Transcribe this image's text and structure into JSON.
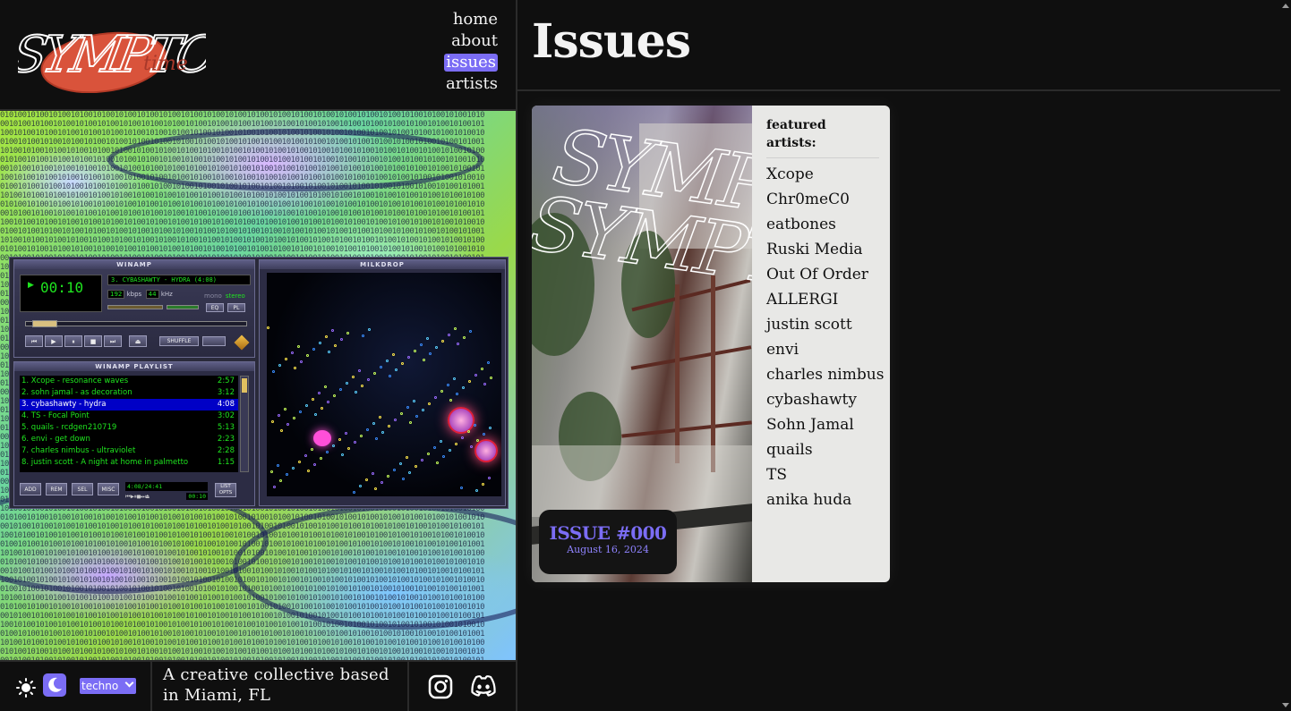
{
  "nav": {
    "items": [
      {
        "label": "home",
        "active": false
      },
      {
        "label": "about",
        "active": false
      },
      {
        "label": "issues",
        "active": true
      },
      {
        "label": "artists",
        "active": false
      }
    ],
    "accent": "#7b6df5"
  },
  "winamp": {
    "title": "WINAMP",
    "time": "00:10",
    "ticker": "3. CYBASHAWTY - HYDRA (4:08)",
    "kbps": "192",
    "kbps_label": "kbps",
    "khz": "44",
    "khz_label": "kHz",
    "mono": "mono",
    "stereo": "stereo",
    "eq": "EQ",
    "pl": "PL",
    "shuffle": "SHUFFLE",
    "playlist_title": "WINAMP PLAYLIST",
    "playlist": [
      {
        "track": "1. Xcope - resonance waves",
        "time": "2:57",
        "selected": false
      },
      {
        "track": "2. sohn jamal - as decoration",
        "time": "3:12",
        "selected": false
      },
      {
        "track": "3. cybashawty - hydra",
        "time": "4:08",
        "selected": true
      },
      {
        "track": "4. TS - Focal Point",
        "time": "3:02",
        "selected": false
      },
      {
        "track": "5. quails - rcdgen210719",
        "time": "5:13",
        "selected": false
      },
      {
        "track": "6. envi - get down",
        "time": "2:23",
        "selected": false
      },
      {
        "track": "7. charles nimbus - ultraviolet",
        "time": "2:28",
        "selected": false
      },
      {
        "track": "8. justin scott - A night at home in palmetto",
        "time": "1:15",
        "selected": false
      }
    ],
    "pl_buttons": [
      "ADD",
      "REM",
      "SEL",
      "MISC"
    ],
    "pl_total": "4:08/24:41",
    "pl_mini_time": "00:10",
    "pl_list_opts": "LIST OPTS",
    "milkdrop_title": "MILKDROP"
  },
  "footer": {
    "genre": "techno",
    "tagline": "A creative collective based in Miami, FL"
  },
  "page": {
    "title": "Issues"
  },
  "issue": {
    "number": "ISSUE #000",
    "date": "August 16, 2024",
    "featured_label": "featured artists:",
    "artists": [
      "Xcope",
      "Chr0meC0",
      "eatbones",
      "Ruski Media",
      "Out Of Order",
      "ALLERGI",
      "justin scott",
      "envi",
      "charles nimbus",
      "cybashawty",
      "Sohn Jamal",
      "quails",
      "TS",
      "anika huda"
    ]
  }
}
